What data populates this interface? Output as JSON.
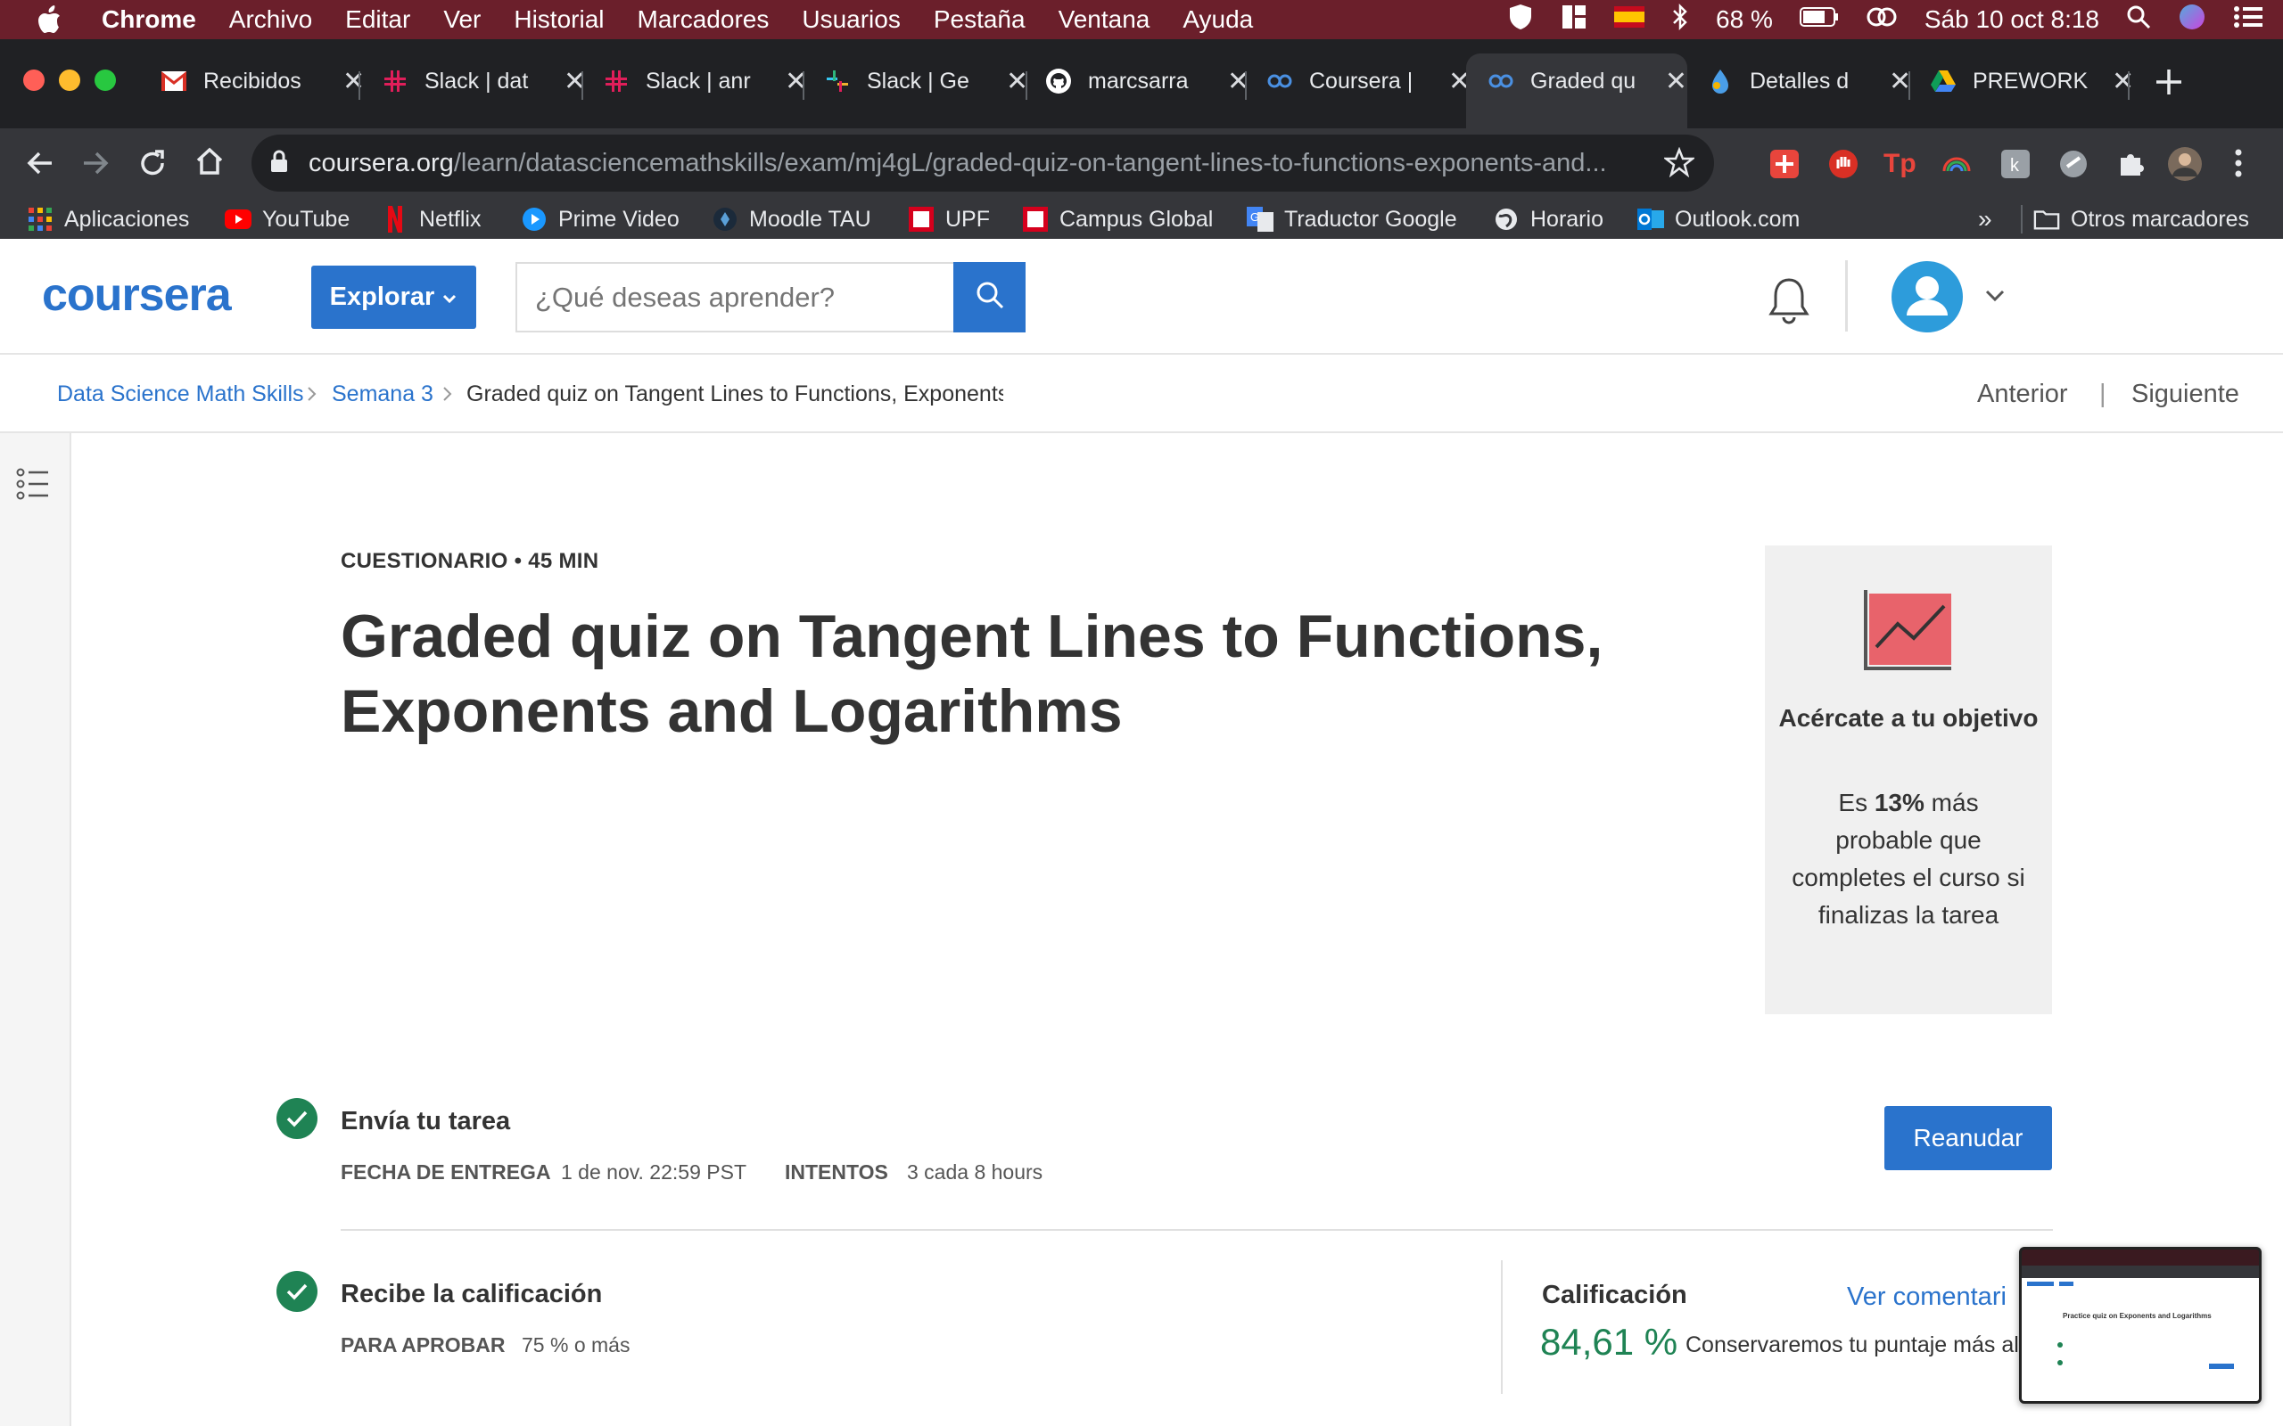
{
  "menubar": {
    "items": [
      "Chrome",
      "Archivo",
      "Editar",
      "Ver",
      "Historial",
      "Marcadores",
      "Usuarios",
      "Pestaña",
      "Ventana",
      "Ayuda"
    ],
    "battery": "68 %",
    "datetime": "Sáb 10 oct  8:18"
  },
  "tabs": [
    {
      "title": "Recibidos",
      "icon": "gmail-icon"
    },
    {
      "title": "Slack | dat",
      "icon": "slack-icon"
    },
    {
      "title": "Slack | anr",
      "icon": "slack-icon"
    },
    {
      "title": "Slack | Ge",
      "icon": "slack-icon"
    },
    {
      "title": "marcsarra",
      "icon": "github-icon"
    },
    {
      "title": "Coursera |",
      "icon": "coursera-icon"
    },
    {
      "title": "Graded qu",
      "icon": "coursera-icon",
      "active": true
    },
    {
      "title": "Detalles d",
      "icon": "drop-icon"
    },
    {
      "title": "PREWORK",
      "icon": "google-drive-icon"
    }
  ],
  "omnibox": {
    "host": "coursera.org",
    "path": "/learn/datasciencemathskills/exam/mj4gL/graded-quiz-on-tangent-lines-to-functions-exponents-and..."
  },
  "bookmarks": [
    {
      "label": "Aplicaciones",
      "icon": "apps-grid-icon"
    },
    {
      "label": "YouTube",
      "icon": "youtube-icon"
    },
    {
      "label": "Netflix",
      "icon": "netflix-icon"
    },
    {
      "label": "Prime Video",
      "icon": "prime-video-icon"
    },
    {
      "label": "Moodle TAU",
      "icon": "moodle-icon"
    },
    {
      "label": "UPF",
      "icon": "upf-icon"
    },
    {
      "label": "Campus Global",
      "icon": "upf-icon"
    },
    {
      "label": "Traductor Google",
      "icon": "google-translate-icon"
    },
    {
      "label": "Horario",
      "icon": "globe-icon"
    },
    {
      "label": "Outlook.com",
      "icon": "outlook-icon"
    }
  ],
  "bookmarks_overflow": "»",
  "bookmarks_other": "Otros marcadores",
  "coursera": {
    "logo": "coursera",
    "explore_label": "Explorar",
    "search_placeholder": "¿Qué deseas aprender?"
  },
  "breadcrumb": {
    "items": [
      "Data Science Math Skills",
      "Semana 3",
      "Graded quiz on Tangent Lines to Functions, Exponents"
    ],
    "prev": "Anterior",
    "separator": "|",
    "next": "Siguiente"
  },
  "quiz": {
    "meta": "CUESTIONARIO • 45 MIN",
    "title": "Graded quiz on Tangent Lines to Functions, Exponents and Logarithms"
  },
  "goal": {
    "heading": "Acércate a tu objetivo",
    "body_prefix": "Es ",
    "body_bold": "13%",
    "body_suffix": " más probable que completes el curso si finalizas la tarea"
  },
  "submit_step": {
    "title": "Envía tu tarea",
    "due_label": "FECHA DE ENTREGA",
    "due_value": "1 de nov. 22:59 PST",
    "attempts_label": "INTENTOS",
    "attempts_value": "3 cada 8 hours",
    "button": "Reanudar"
  },
  "grade_step": {
    "title": "Recibe la calificación",
    "pass_label": "PARA APROBAR",
    "pass_value": "75 % o más",
    "grade_label": "Calificación",
    "grade_value": "84,61 %",
    "grade_note": "Conservaremos tu puntaje más al",
    "feedback_link": "Ver comentari"
  },
  "thumbnail": {
    "title": "Practice quiz on Exponents and Logarithms"
  },
  "colors": {
    "menubar": "#6b1f2b",
    "chrome_dark": "#202124",
    "chrome_toolbar": "#35363a",
    "coursera_blue": "#2a73cc",
    "success_green": "#1f8354",
    "goal_card_bg": "#f0f0f0",
    "chart_icon_fill": "#e8636b"
  }
}
